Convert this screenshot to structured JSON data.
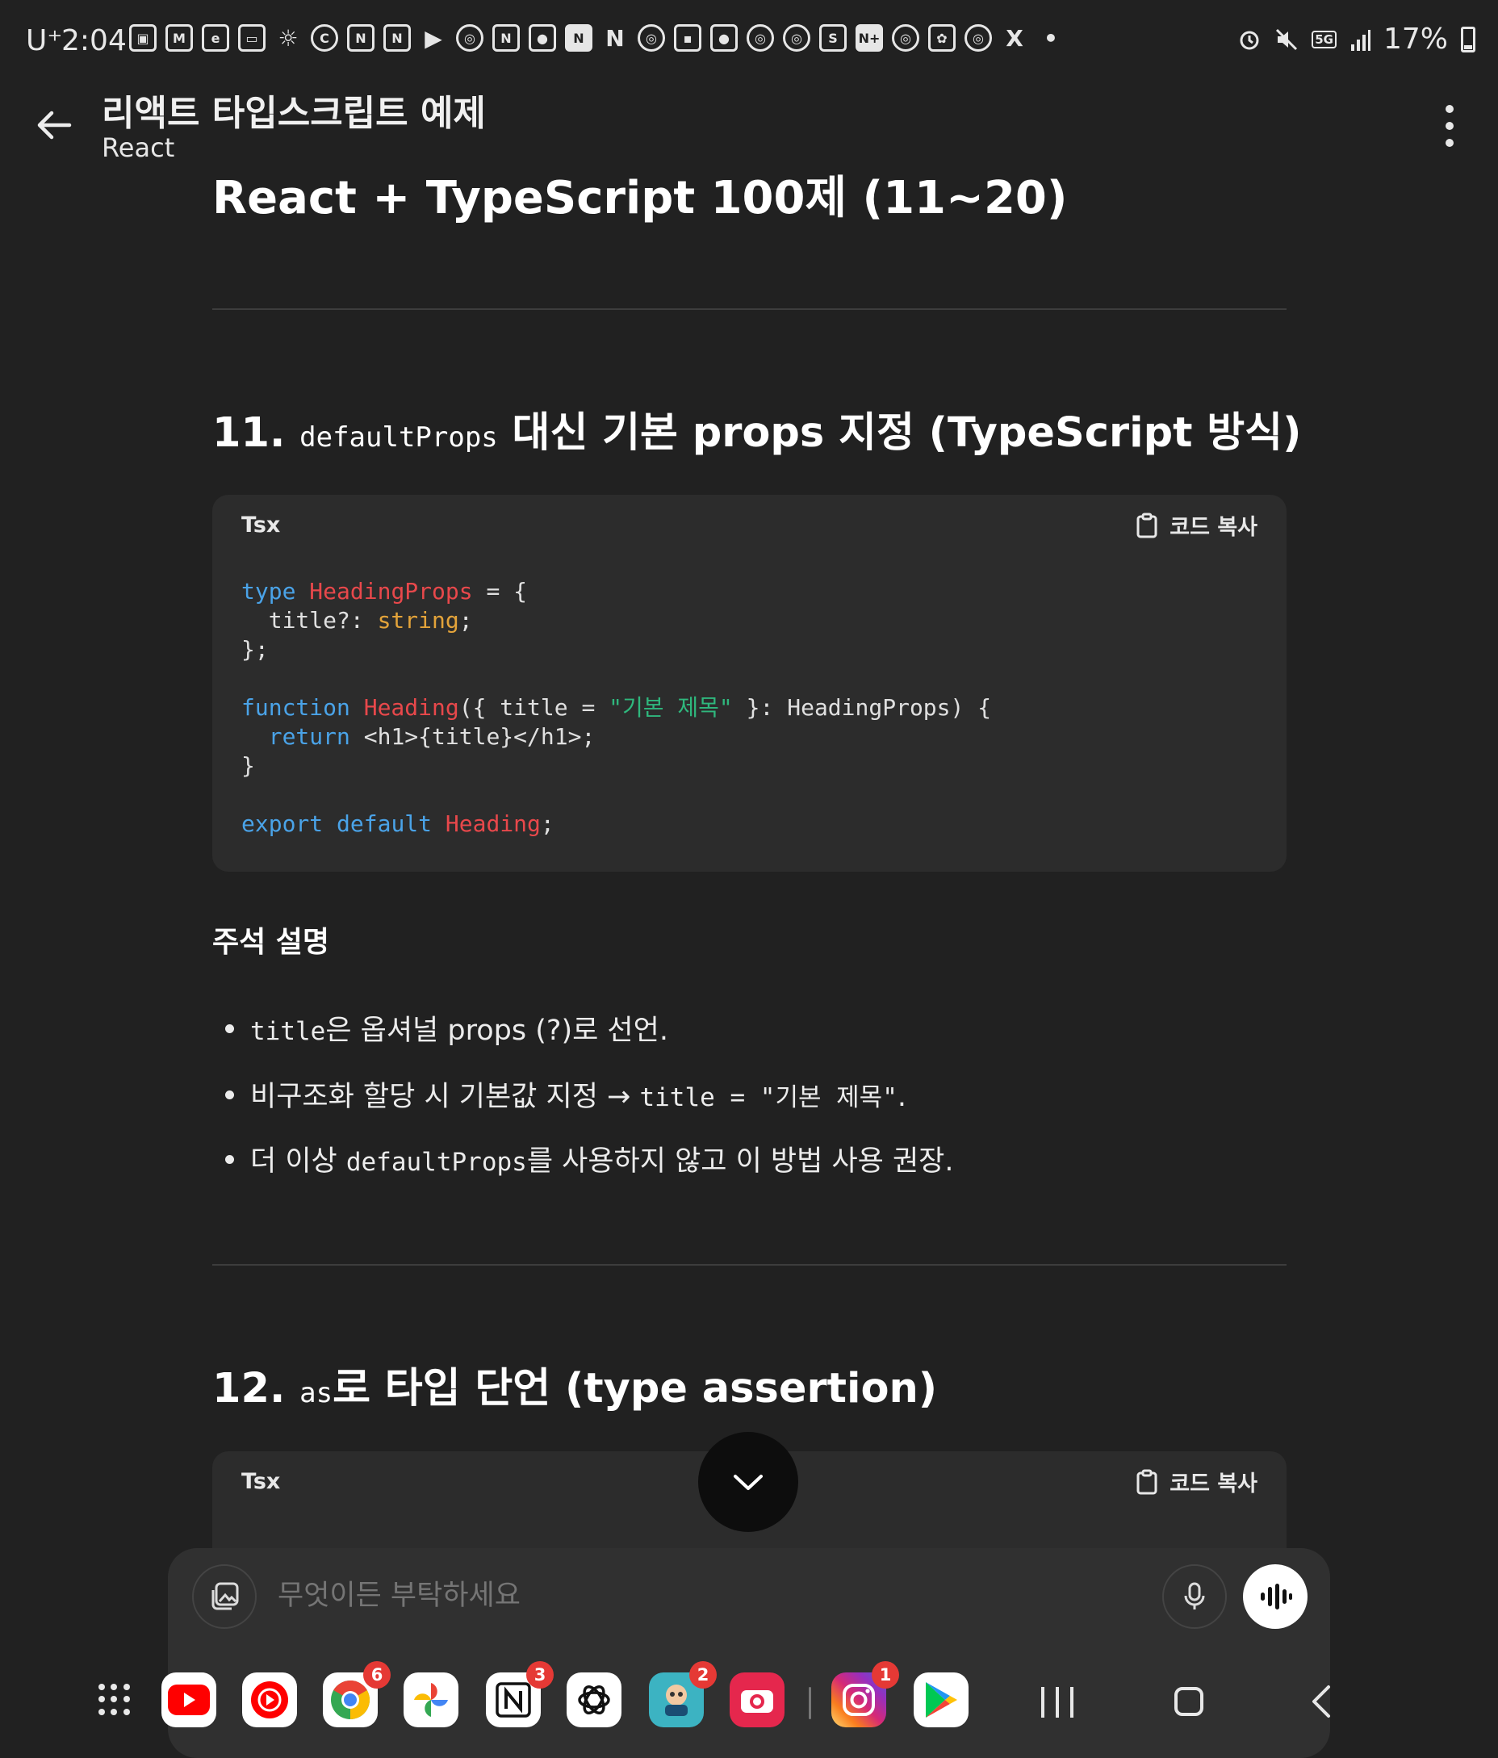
{
  "status_bar": {
    "carrier": "U⁺",
    "time": "2:04",
    "notification_icons": [
      "gallery-icon",
      "gmail-icon",
      "eats-icon",
      "game-icon",
      "brightness-icon",
      "c-icon",
      "naver-n-icon",
      "naver-n-icon",
      "play-icon",
      "chrome-icon",
      "naver-n-icon",
      "won-icon",
      "notion-icon",
      "netflix-icon",
      "chrome-icon",
      "app-icon",
      "won-icon",
      "chrome-icon",
      "chrome-icon",
      "s-icon",
      "nplus-icon",
      "chrome-icon",
      "chatgpt-icon",
      "chrome-icon",
      "x-icon",
      "dot-icon"
    ],
    "signal_label": "5G",
    "battery": "17%"
  },
  "header": {
    "title": "리액트 타입스크립트 예제",
    "subtitle": "React"
  },
  "content": {
    "prev_heading": "React + TypeScript 100제 (11~20)",
    "section11": {
      "number": "11.",
      "code_term": "defaultProps",
      "rest": " 대신 기본 props 지정 (TypeScript 방식)"
    },
    "code11": {
      "lang": "Tsx",
      "copy_label": "코드 복사"
    },
    "notes": {
      "title": "주석 설명",
      "b1_code": "title",
      "b1_text": "은 옵셔널 props (?)로 선언.",
      "b2_text": "비구조화 할당 시 기본값 지정 → ",
      "b2_code": "title = \"기본 제목\"",
      "b2_end": ".",
      "b3_text": "더 이상 ",
      "b3_code": "defaultProps",
      "b3_end": "를 사용하지 않고 이 방법 사용 권장."
    },
    "section12": {
      "number": "12.",
      "code_term": "as",
      "rest": "로 타입 단언 (type assertion)"
    },
    "code12": {
      "lang": "Tsx",
      "copy_label": "코드 복사"
    }
  },
  "prompt": {
    "placeholder": "무엇이든 부탁하세요"
  },
  "taskbar": {
    "apps": [
      {
        "name": "youtube-app",
        "color": "#ff0000"
      },
      {
        "name": "youtube-music-app",
        "color": "#ff0000"
      },
      {
        "name": "chrome-app",
        "badge": "6"
      },
      {
        "name": "photos-app"
      },
      {
        "name": "notion-app",
        "badge": "3"
      },
      {
        "name": "chatgpt-app"
      },
      {
        "name": "game-app",
        "badge": "2",
        "label": "배민커넥트"
      },
      {
        "name": "camera-app",
        "color": "#e5274d"
      },
      {
        "name": "instagram-app",
        "badge": "1"
      },
      {
        "name": "play-store-app"
      }
    ]
  }
}
